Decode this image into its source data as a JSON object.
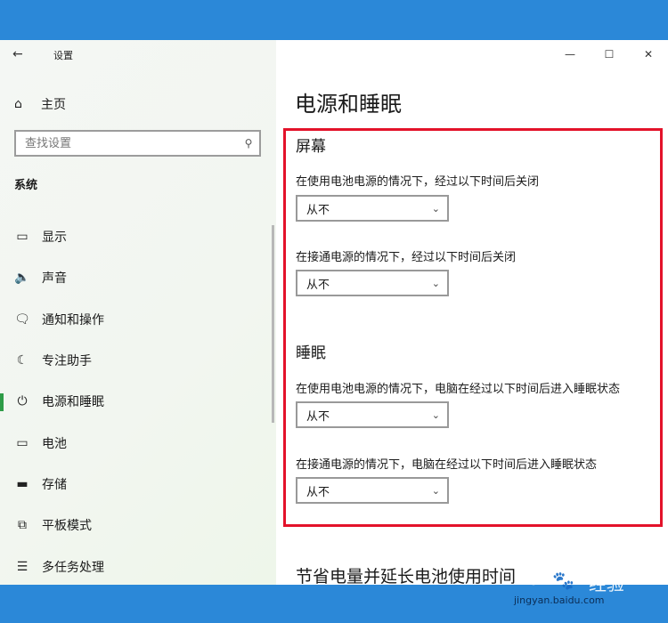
{
  "window": {
    "app_title": "设置"
  },
  "titlebar": {
    "minimize": "—",
    "maximize": "☐",
    "close": "✕"
  },
  "sidebar": {
    "home_label": "主页",
    "search_placeholder": "查找设置",
    "section_title": "系统",
    "items": [
      {
        "label": "显示",
        "icon": "display-icon",
        "glyph": "▭"
      },
      {
        "label": "声音",
        "icon": "speaker-icon",
        "glyph": "🔈"
      },
      {
        "label": "通知和操作",
        "icon": "notification-icon",
        "glyph": "🗨"
      },
      {
        "label": "专注助手",
        "icon": "moon-icon",
        "glyph": "☾"
      },
      {
        "label": "电源和睡眠",
        "icon": "power-icon",
        "glyph": "⏻"
      },
      {
        "label": "电池",
        "icon": "battery-icon",
        "glyph": "▭"
      },
      {
        "label": "存储",
        "icon": "storage-icon",
        "glyph": "▬"
      },
      {
        "label": "平板模式",
        "icon": "tablet-mode-icon",
        "glyph": "⧉"
      },
      {
        "label": "多任务处理",
        "icon": "multitasking-icon",
        "glyph": "☰"
      }
    ],
    "active_index": 4
  },
  "main": {
    "page_title": "电源和睡眠",
    "screen": {
      "heading": "屏幕",
      "battery_desc": "在使用电池电源的情况下，经过以下时间后关闭",
      "battery_value": "从不",
      "plugged_desc": "在接通电源的情况下，经过以下时间后关闭",
      "plugged_value": "从不"
    },
    "sleep": {
      "heading": "睡眠",
      "battery_desc": "在使用电池电源的情况下，电脑在经过以下时间后进入睡眠状态",
      "battery_value": "从不",
      "plugged_desc": "在接通电源的情况下，电脑在经过以下时间后进入睡眠状态",
      "plugged_value": "从不"
    },
    "bottom_title": "节省电量并延长电池使用时间"
  },
  "watermark": {
    "logo": "Bai",
    "brand_cn": "经验",
    "url": "jingyan.baidu.com"
  },
  "colors": {
    "accent": "#2e9c47",
    "highlight_border": "#e3122a",
    "frame_blue": "#2b88d8"
  }
}
